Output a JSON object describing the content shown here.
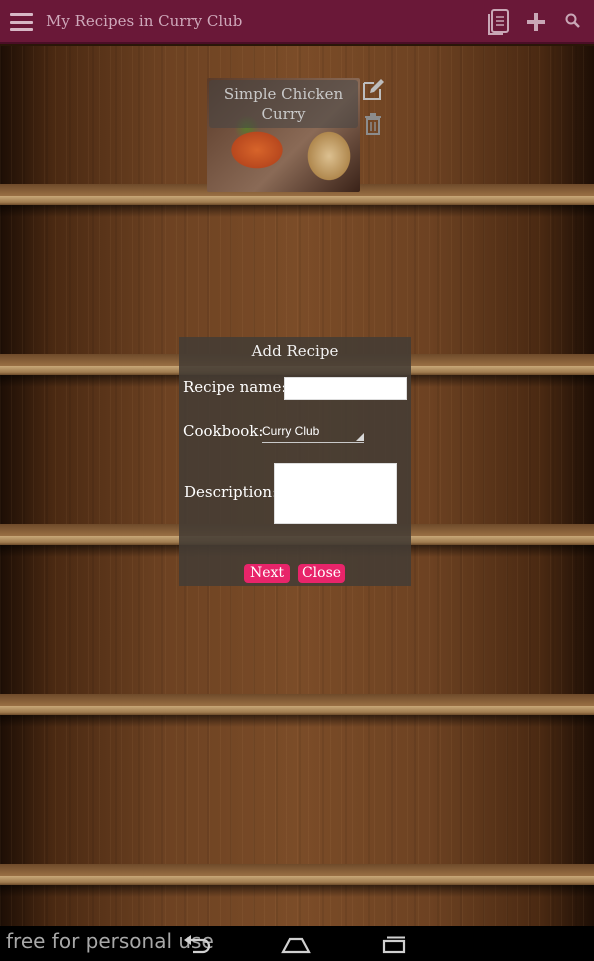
{
  "app": {
    "title": "My Recipes in Curry Club",
    "brand_color": "#6a1838",
    "accent_color": "#e8246a"
  },
  "toolbar": {
    "menu_icon": "hamburger-menu-icon",
    "actions": [
      "cookbooks-icon",
      "add-icon",
      "search-icon"
    ]
  },
  "shelf": {
    "recipes": [
      {
        "name": "Simple Chicken Curry",
        "edit_icon": "edit-icon",
        "delete_icon": "trash-icon"
      }
    ]
  },
  "dialog": {
    "title": "Add Recipe",
    "recipe_name_label": "Recipe name:",
    "recipe_name_value": "",
    "cookbook_label": "Cookbook:",
    "cookbook_selected": "Curry Club",
    "description_label": "Description:",
    "description_value": "",
    "next_label": "Next",
    "close_label": "Close"
  },
  "system": {
    "watermark": "free for personal use",
    "nav_icons": [
      "back-icon",
      "home-icon",
      "recents-icon"
    ]
  }
}
